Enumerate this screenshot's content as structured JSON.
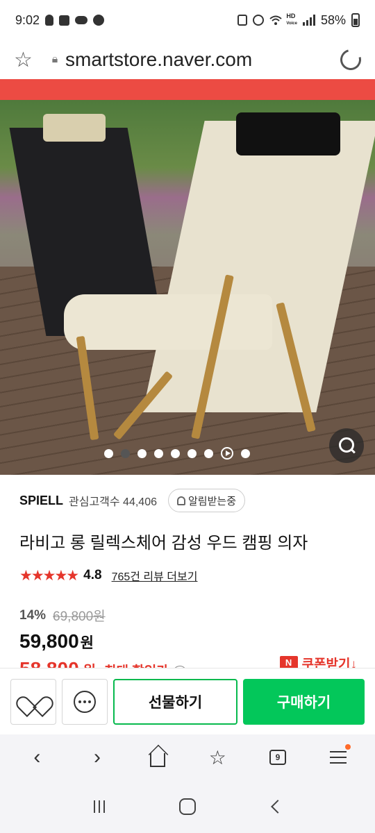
{
  "status_bar": {
    "time": "9:02",
    "battery": "58%",
    "hd_label": "HD",
    "volte_label": "Voice"
  },
  "url_bar": {
    "url": "smartstore.naver.com"
  },
  "product_image": {
    "dot_count": 9,
    "active_index": 1
  },
  "product": {
    "brand": "SPIELL",
    "interest_label": "관심고객수 44,406",
    "alert_button": "알림받는중",
    "title": "라비고 롱 릴렉스체어 감성 우드 캠핑 의자",
    "stars": "★★★★★",
    "rating": "4.8",
    "review_link": "765건 리뷰 더보기",
    "discount_pct": "14%",
    "original_price": "69,800원",
    "price": "59,800",
    "price_unit": "원",
    "best_price": "58,800",
    "best_price_unit": "원",
    "best_price_label": "최대 할인가",
    "info_icon_char": "i",
    "coupon_badge": "N",
    "coupon_label": "쿠폰받기↓"
  },
  "purchase_bar": {
    "gift_label": "선물하기",
    "buy_label": "구매하기"
  },
  "browser_nav": {
    "back_char": "‹",
    "forward_char": "›",
    "tabs_count": "9"
  },
  "colors": {
    "brand_green": "#03c75a",
    "price_red": "#e5352b",
    "strip_red": "#ec4b43"
  }
}
